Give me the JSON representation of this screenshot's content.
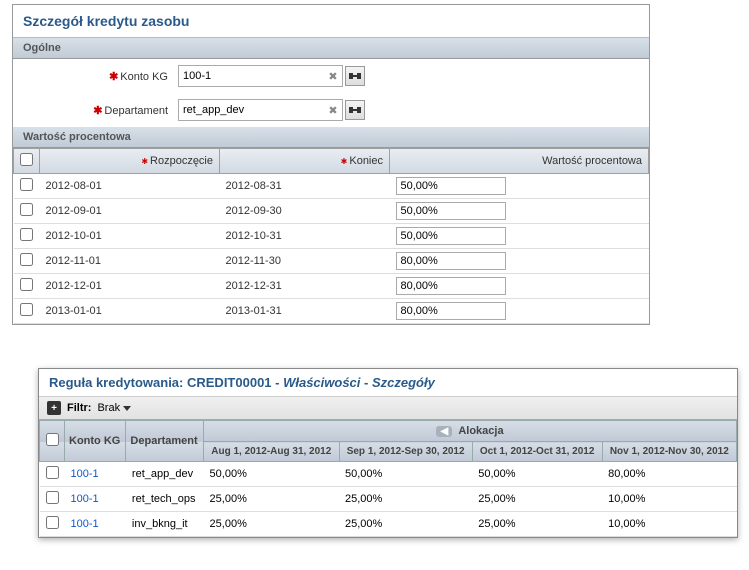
{
  "panel1": {
    "title": "Szczegół kredytu zasobu",
    "sections": {
      "general": "Ogólne",
      "percent": "Wartość procentowa"
    },
    "fields": {
      "kg": {
        "label": "Konto KG",
        "value": "100-1"
      },
      "dept": {
        "label": "Departament",
        "value": "ret_app_dev"
      }
    },
    "columns": {
      "start": "Rozpoczęcie",
      "end": "Koniec",
      "pct": "Wartość procentowa"
    },
    "rows": [
      {
        "start": "2012-08-01",
        "end": "2012-08-31",
        "pct": "50,00%"
      },
      {
        "start": "2012-09-01",
        "end": "2012-09-30",
        "pct": "50,00%"
      },
      {
        "start": "2012-10-01",
        "end": "2012-10-31",
        "pct": "50,00%"
      },
      {
        "start": "2012-11-01",
        "end": "2012-11-30",
        "pct": "80,00%"
      },
      {
        "start": "2012-12-01",
        "end": "2012-12-31",
        "pct": "80,00%"
      },
      {
        "start": "2013-01-01",
        "end": "2013-01-31",
        "pct": "80,00%"
      }
    ]
  },
  "panel2": {
    "title_prefix": "Reguła kredytowania: ",
    "title_id": "CREDIT00001",
    "title_sep": " - ",
    "title_prop": "Właściwości",
    "title_detail": "Szczegóły",
    "filter_label": "Filtr:",
    "filter_value": "Brak",
    "columns": {
      "kg": "Konto KG",
      "dept": "Departament",
      "alloc": "Alokacja",
      "p1": "Aug 1, 2012-Aug 31, 2012",
      "p2": "Sep 1, 2012-Sep 30, 2012",
      "p3": "Oct 1, 2012-Oct 31, 2012",
      "p4": "Nov 1, 2012-Nov 30, 2012"
    },
    "rows": [
      {
        "kg": "100-1",
        "dept": "ret_app_dev",
        "p1": "50,00%",
        "p2": "50,00%",
        "p3": "50,00%",
        "p4": "80,00%"
      },
      {
        "kg": "100-1",
        "dept": "ret_tech_ops",
        "p1": "25,00%",
        "p2": "25,00%",
        "p3": "25,00%",
        "p4": "10,00%"
      },
      {
        "kg": "100-1",
        "dept": "inv_bkng_it",
        "p1": "25,00%",
        "p2": "25,00%",
        "p3": "25,00%",
        "p4": "10,00%"
      }
    ]
  }
}
